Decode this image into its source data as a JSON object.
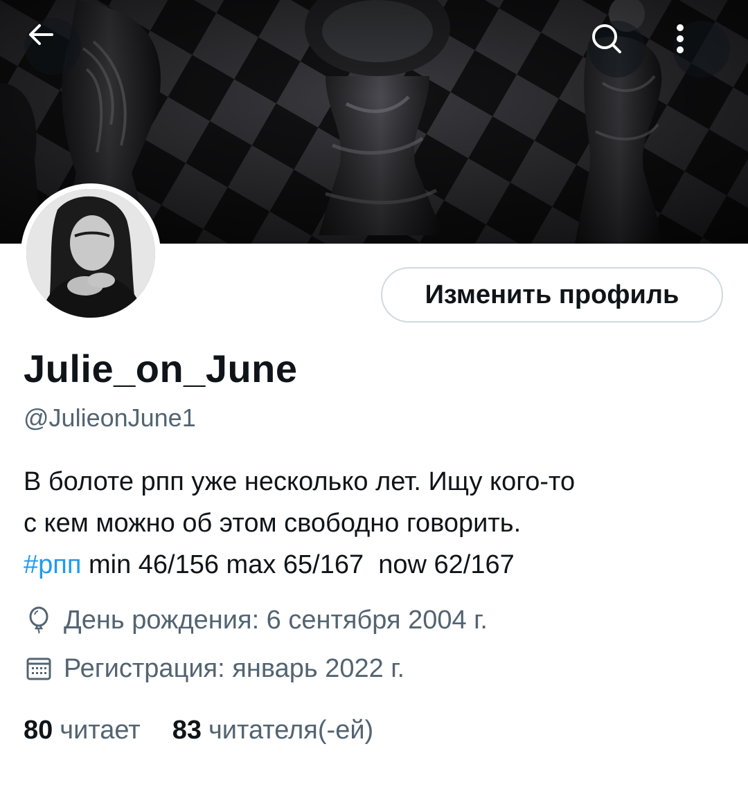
{
  "header": {
    "back_icon": "arrow-left-icon",
    "search_icon": "search-icon",
    "more_icon": "more-vertical-icon"
  },
  "profile": {
    "edit_button_label": "Изменить профиль",
    "display_name": "Julie_on_June",
    "handle": "@JulieonJune1",
    "bio_line1": "В болоте рпп уже несколько лет. Ищу кого-то",
    "bio_line2": "с кем можно об этом свободно говорить.",
    "bio_hashtag": "#рпп",
    "bio_line3_rest": " min 46/156 max 65/167  now 62/167",
    "birthday": "День рождения: 6 сентября 2004 г.",
    "joined": "Регистрация: январь 2022 г.",
    "following_count": "80",
    "following_label": "читает",
    "followers_count": "83",
    "followers_label": "читателя(-ей)"
  },
  "colors": {
    "link": "#1d9bf0",
    "secondary_text": "#536471",
    "primary_text": "#0f1419",
    "border": "#cfd9de"
  }
}
